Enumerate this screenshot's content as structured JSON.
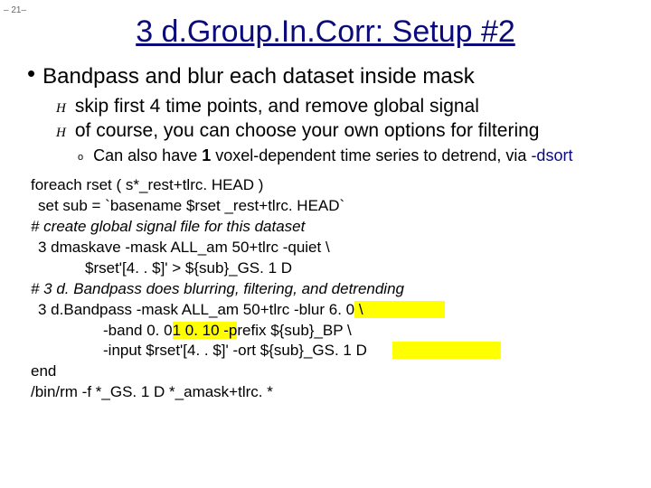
{
  "page_number": "– 21–",
  "title": "3 d.Group.In.Corr: Setup #2",
  "bullet_main": "Bandpass and blur each dataset inside mask",
  "sub": {
    "a": "skip first 4 time points, and remove global signal",
    "b": "of course, you can choose your own options for filtering"
  },
  "subsub_pre": "Can also have ",
  "subsub_bold": "1",
  "subsub_mid": " voxel-dependent time series to detrend, via ",
  "subsub_dsort": "-dsort",
  "code": {
    "l1": "foreach rset ( s*_rest+tlrc. HEAD )",
    "l2": "set sub = `basename $rset _rest+tlrc. HEAD`",
    "l3": "# create global signal file for this dataset",
    "l4": "3 dmaskave -mask ALL_am 50+tlrc -quiet   \\",
    "l5": "$rset'[4. . $]' > ${sub}_GS. 1 D",
    "l6": "# 3 d. Bandpass does blurring, filtering, and detrending",
    "l7a": "3 d.Bandpass -mask ALL_am 50+tlrc -blur 6. 0",
    "l7b": "     \\",
    "l8a": "-band 0. 0",
    "l8b": "1 0. 10 -p",
    "l8c": "refix ${sub}_BP \\",
    "l9a": "-input $rset'[4. . $]' -ort ${sub}_GS. 1 D",
    "l9b": " ",
    "l10": "end",
    "l11": "/bin/rm -f *_GS. 1 D *_amask+tlrc. *"
  }
}
